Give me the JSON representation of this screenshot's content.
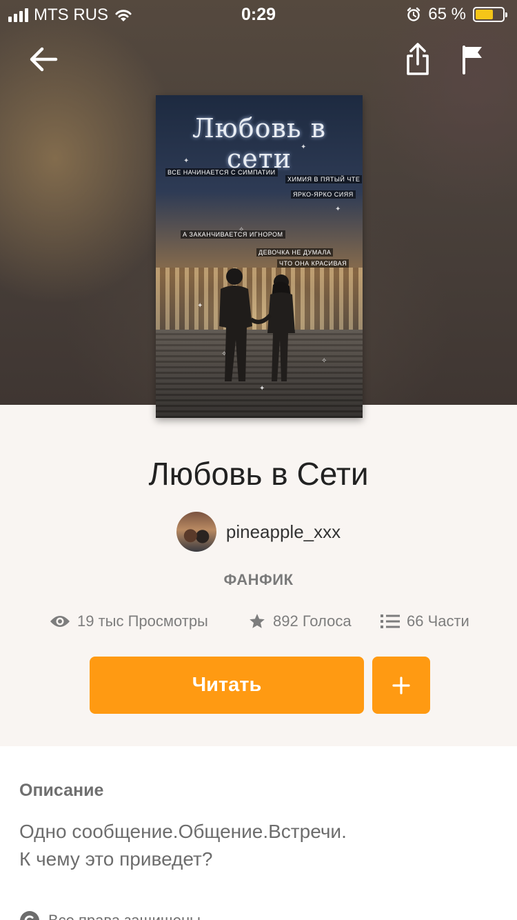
{
  "status_bar": {
    "carrier": "MTS RUS",
    "time": "0:29",
    "battery_percent": "65 %",
    "battery_level": 0.65,
    "battery_color": "#f5c518"
  },
  "nav": {
    "back_icon": "arrow-left-icon",
    "share_icon": "share-icon",
    "report_icon": "flag-icon"
  },
  "cover": {
    "title": "Любовь в сети",
    "lines": [
      "ВСЕ НАЧИНАЕТСЯ С СИМПАТИИ",
      "ХИМИЯ В ПЯТЫЙ ЧТЕ",
      "ЯРКО-ЯРКО СИЯЯ",
      "А ЗАКАНЧИВАЕТСЯ ИГНОРОМ",
      "ДЕВОЧКА НЕ ДУМАЛА",
      "ЧТО ОНА КРАСИВАЯ"
    ]
  },
  "story": {
    "title": "Любовь в Сети",
    "author": "pineapple_xxx",
    "category": "ФАНФИК"
  },
  "stats": {
    "views": "19 тыс Просмотры",
    "votes": "892 Голоса",
    "parts": "66 Части"
  },
  "actions": {
    "read_label": "Читать",
    "add_icon": "plus-icon"
  },
  "description": {
    "heading": "Описание",
    "lines": [
      "Одно сообщение.Общение.Встречи.",
      "К чему это приведет?"
    ]
  },
  "footer": {
    "rights": "Все права защищены"
  },
  "colors": {
    "accent": "#ff9a12",
    "page_bg": "#f9f5f2",
    "panel_bg": "#ffffff"
  }
}
